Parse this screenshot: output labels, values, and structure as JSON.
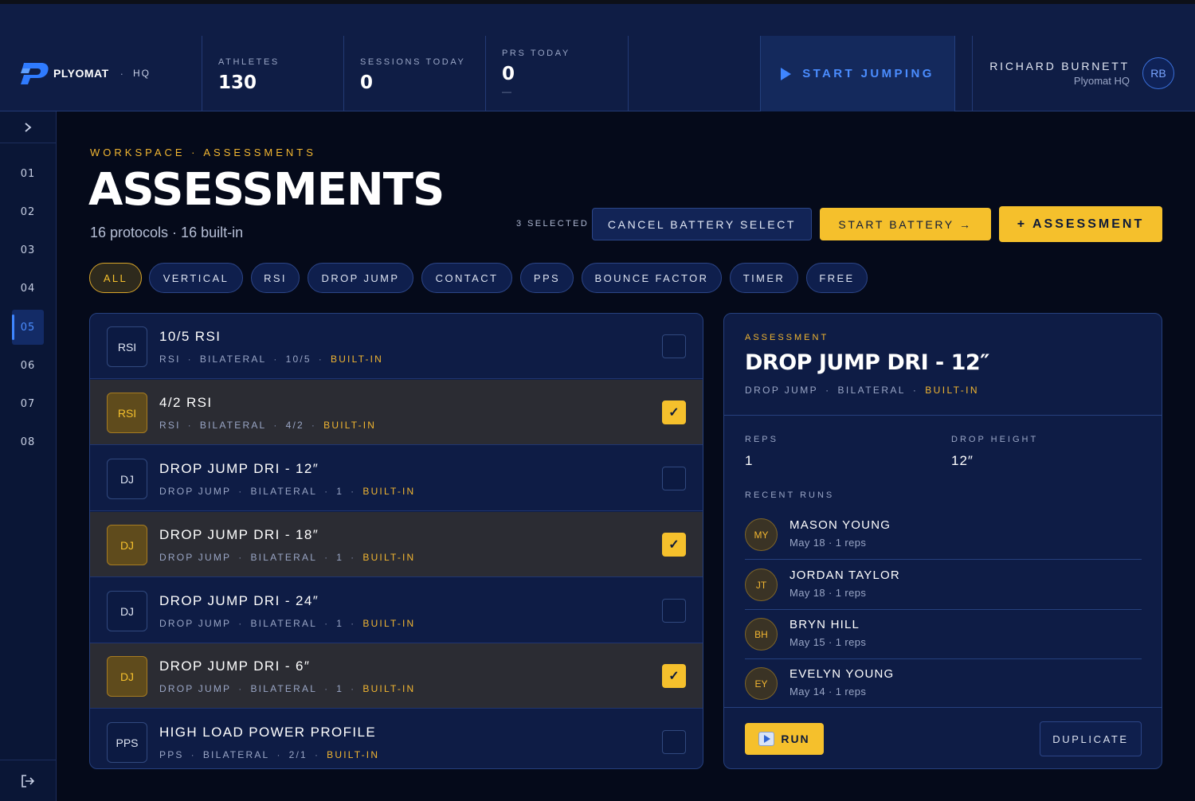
{
  "header": {
    "brand_name": "PLYOMAT",
    "brand_sep": "·",
    "brand_suffix": "HQ",
    "stats": [
      {
        "label": "ATHLETES",
        "value": "130",
        "sub": ""
      },
      {
        "label": "SESSIONS TODAY",
        "value": "0",
        "sub": ""
      },
      {
        "label": "PRS TODAY",
        "value": "0",
        "sub": "—"
      }
    ],
    "start_button": "START JUMPING",
    "user_name": "RICHARD BURNETT",
    "user_org": "Plyomat HQ",
    "user_initials": "RB"
  },
  "sidebar": {
    "toggle_icon": "chevron-right-icon",
    "items": [
      "01",
      "02",
      "03",
      "04",
      "05",
      "06",
      "07",
      "08"
    ],
    "active_index": 4,
    "bottom_icon": "logout-icon"
  },
  "page": {
    "breadcrumb": "WORKSPACE · ASSESSMENTS",
    "title": "ASSESSMENTS",
    "subtitle": "16 protocols · 16 built-in",
    "selected_count": "3 SELECTED",
    "cancel_button": "CANCEL BATTERY SELECT",
    "start_battery_button": "START BATTERY →",
    "add_button": "+ ASSESSMENT"
  },
  "filters": [
    "ALL",
    "VERTICAL",
    "RSI",
    "DROP JUMP",
    "CONTACT",
    "PPS",
    "BOUNCE FACTOR",
    "TIMER",
    "FREE"
  ],
  "active_filter": "ALL",
  "protocols": [
    {
      "badge": "RSI",
      "title": "10/5 RSI",
      "type": "RSI",
      "side": "BILATERAL",
      "reps": "10/5",
      "origin": "BUILT-IN",
      "selected": false
    },
    {
      "badge": "RSI",
      "title": "4/2 RSI",
      "type": "RSI",
      "side": "BILATERAL",
      "reps": "4/2",
      "origin": "BUILT-IN",
      "selected": true
    },
    {
      "badge": "DJ",
      "title": "DROP JUMP DRI - 12″",
      "type": "DROP JUMP",
      "side": "BILATERAL",
      "reps": "1",
      "origin": "BUILT-IN",
      "selected": false
    },
    {
      "badge": "DJ",
      "title": "DROP JUMP DRI - 18″",
      "type": "DROP JUMP",
      "side": "BILATERAL",
      "reps": "1",
      "origin": "BUILT-IN",
      "selected": true
    },
    {
      "badge": "DJ",
      "title": "DROP JUMP DRI - 24″",
      "type": "DROP JUMP",
      "side": "BILATERAL",
      "reps": "1",
      "origin": "BUILT-IN",
      "selected": false
    },
    {
      "badge": "DJ",
      "title": "DROP JUMP DRI - 6″",
      "type": "DROP JUMP",
      "side": "BILATERAL",
      "reps": "1",
      "origin": "BUILT-IN",
      "selected": true
    },
    {
      "badge": "PPS",
      "title": "HIGH LOAD POWER PROFILE",
      "type": "PPS",
      "side": "BILATERAL",
      "reps": "2/1",
      "origin": "BUILT-IN",
      "selected": false
    }
  ],
  "detail": {
    "eyebrow": "ASSESSMENT",
    "title": "DROP JUMP DRI - 12″",
    "type": "DROP JUMP",
    "side": "BILATERAL",
    "origin": "BUILT-IN",
    "reps_label": "REPS",
    "reps_value": "1",
    "height_label": "DROP HEIGHT",
    "height_value": "12″",
    "recent_label": "RECENT RUNS",
    "runs": [
      {
        "initials": "MY",
        "name": "MASON YOUNG",
        "meta": "May 18 · 1 reps"
      },
      {
        "initials": "JT",
        "name": "JORDAN TAYLOR",
        "meta": "May 18 · 1 reps"
      },
      {
        "initials": "BH",
        "name": "BRYN HILL",
        "meta": "May 15 · 1 reps"
      },
      {
        "initials": "EY",
        "name": "EVELYN YOUNG",
        "meta": "May 14 · 1 reps"
      }
    ],
    "run_button": "RUN",
    "duplicate_button": "DUPLICATE"
  },
  "colors": {
    "accent_blue": "#3f86ff",
    "accent_yellow": "#f5c02c",
    "background": "#050a1a",
    "panel": "#0e1c45"
  }
}
